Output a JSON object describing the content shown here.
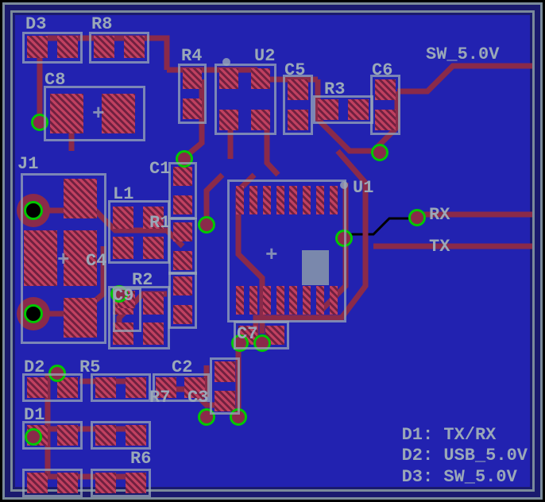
{
  "labels": {
    "D3": "D3",
    "R8": "R8",
    "C8": "C8",
    "R4": "R4",
    "U2": "U2",
    "C5": "C5",
    "C6": "C6",
    "SW_50V": "SW_5.0V",
    "J1": "J1",
    "L1": "L1",
    "C1": "C1",
    "R1": "R1",
    "U1": "U1",
    "RX": "RX",
    "TX": "TX",
    "C4": "C4",
    "R2": "R2",
    "C9": "C9",
    "C7": "C7",
    "D2": "D2",
    "R5": "R5",
    "C2": "C2",
    "R7": "R7",
    "C3": "C3",
    "D1": "D1",
    "R6": "R6",
    "R3": "R3"
  },
  "legend": {
    "l1": "D1: TX/RX",
    "l2": "D2: USB_5.0V",
    "l3": "D3: SW_5.0V"
  }
}
